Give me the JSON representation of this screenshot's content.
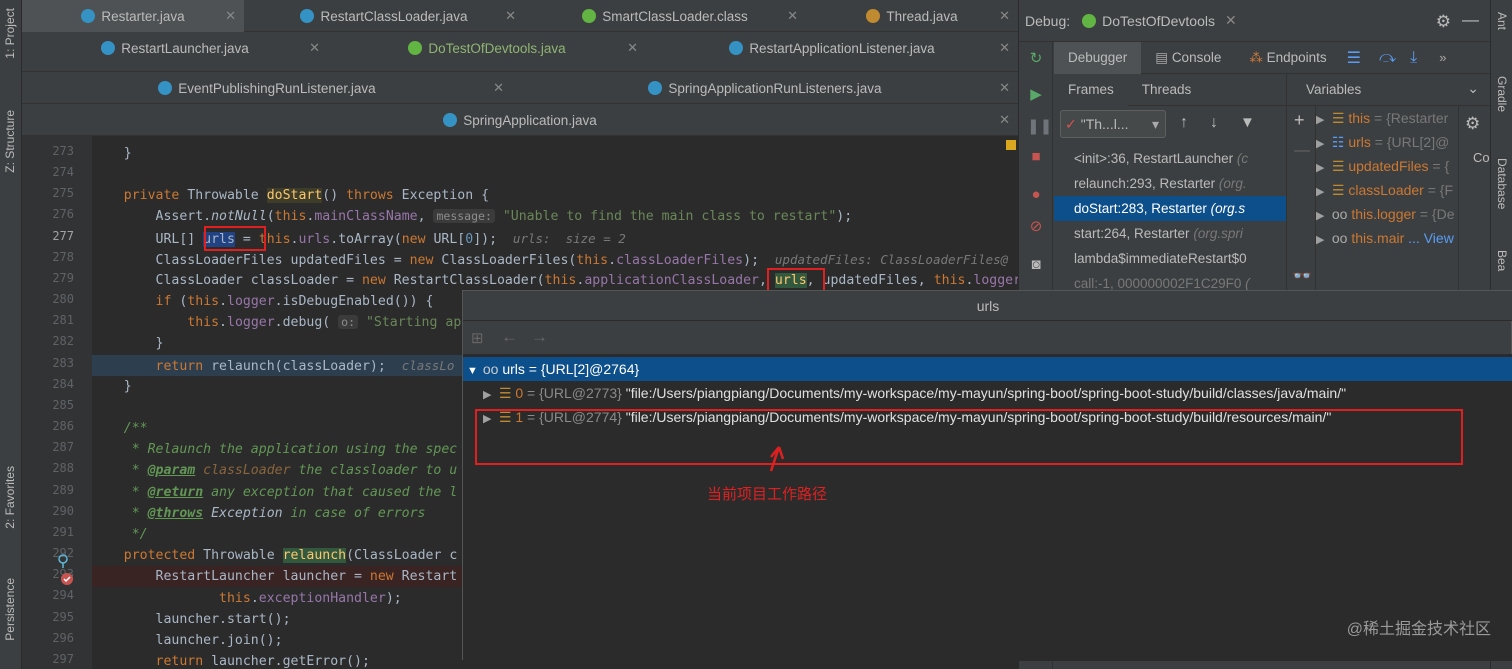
{
  "left_strip": {
    "items": [
      "1: Project",
      "Z: Structure",
      "2: Favorites",
      "Persistence"
    ]
  },
  "editor": {
    "tabs_row1": [
      {
        "label": "Restarter.java",
        "icon": "java-class-icon"
      },
      {
        "label": "RestartClassLoader.java",
        "icon": "java-class-icon"
      },
      {
        "label": "SmartClassLoader.class",
        "icon": "interface-icon"
      },
      {
        "label": "Thread.java",
        "icon": "java-class-icon"
      }
    ],
    "tabs_row2": [
      {
        "label": "RestartLauncher.java",
        "icon": "java-class-icon"
      },
      {
        "label": "DoTestOfDevtools.java",
        "icon": "spring-icon"
      },
      {
        "label": "RestartApplicationListener.java",
        "icon": "java-class-icon"
      }
    ],
    "tabs_row3": [
      {
        "label": "EventPublishingRunListener.java",
        "icon": "java-class-icon"
      },
      {
        "label": "SpringApplicationRunListeners.java",
        "icon": "java-class-icon"
      }
    ],
    "tabs_row4": [
      {
        "label": "SpringApplication.java",
        "icon": "java-class-icon"
      }
    ],
    "line_numbers": [
      "273",
      "274",
      "275",
      "276",
      "277",
      "278",
      "279",
      "280",
      "281",
      "282",
      "283",
      "284",
      "285",
      "286",
      "287",
      "288",
      "289",
      "290",
      "291",
      "292",
      "293",
      "294",
      "295",
      "296",
      "297"
    ],
    "code": {
      "l273": "}",
      "l275_kw": "private",
      "l275_type": " Throwable ",
      "l275_name": "doStart",
      "l275_rest": "() ",
      "l275_throws": "throws",
      "l275_exc": " Exception {",
      "l276_a": "Assert.",
      "l276_b": "notNull",
      "l276_c": "(",
      "l276_this": "this",
      "l276_d": ".",
      "l276_field": "mainClassName",
      "l276_e": ",",
      "l276_hint": "message:",
      "l276_str": "\"Unable to find the main class to restart\"",
      "l276_f": ");",
      "l277_a": "URL[] ",
      "l277_var": "urls",
      "l277_b": " = ",
      "l277_this": "this",
      "l277_c": ".",
      "l277_field": "urls",
      "l277_d": ".toArray(",
      "l277_new": "new",
      "l277_e": " URL[",
      "l277_num": "0",
      "l277_f": "]);",
      "l277_hint": "urls:  size = 2",
      "l278_a": "ClassLoaderFiles updatedFiles = ",
      "l278_new": "new",
      "l278_b": " ClassLoaderFiles(",
      "l278_this": "this",
      "l278_c": ".",
      "l278_field": "classLoaderFiles",
      "l278_d": ");",
      "l278_hint": "updatedFiles: ClassLoaderFiles@",
      "l279_a": "ClassLoader classLoader = ",
      "l279_new": "new",
      "l279_b": " RestartClassLoader(",
      "l279_this": "this",
      "l279_c": ".",
      "l279_field": "applicationClassLoader",
      "l279_d": ", ",
      "l279_var": "urls",
      "l279_e": ", updatedFiles, ",
      "l279_this2": "this",
      "l279_f": ".",
      "l279_field2": "logger",
      "l280_if": "if",
      "l280_a": " (",
      "l280_this": "this",
      "l280_b": ".",
      "l280_field": "logger",
      "l280_c": ".isDebugEnabled()) {",
      "l281_this": "this",
      "l281_a": ".",
      "l281_field": "logger",
      "l281_b": ".debug(",
      "l281_hint": "o:",
      "l281_str": "\"Starting app",
      "l282": "}",
      "l283_ret": "return",
      "l283_a": " relaunch(classLoader);",
      "l283_hint": "classLo",
      "l284": "}",
      "l286": "/**",
      "l287": " * Relaunch the application using the spec",
      "l288_a": " * ",
      "l288_tag": "@param",
      "l288_b": " classLoader",
      "l288_c": " the classloader to u",
      "l289_a": " * ",
      "l289_tag": "@return",
      "l289_b": " any exception that caused the l",
      "l290_a": " * ",
      "l290_tag": "@throws",
      "l290_b": " Exception",
      "l290_c": " in case of errors",
      "l291": " */",
      "l292_kw": "protected",
      "l292_a": " Throwable ",
      "l292_name": "relaunch",
      "l292_b": "(ClassLoader c",
      "l293_a": "RestartLauncher launcher = ",
      "l293_new": "new",
      "l293_b": " Restart",
      "l294_this": "this",
      "l294_a": ".",
      "l294_field": "exceptionHandler",
      "l294_b": ");",
      "l295": "launcher.start();",
      "l296": "launcher.join();",
      "l297_ret": "return",
      "l297_a": " launcher.getError();"
    }
  },
  "debug": {
    "header_label": "Debug:",
    "session_name": "DoTestOfDevtools",
    "tabs": [
      "Debugger",
      "Console",
      "Endpoints"
    ],
    "subtabs": [
      "Frames",
      "Threads"
    ],
    "variables_label": "Variables",
    "thread_select": "\"Th...l...",
    "frames": [
      {
        "name": "<init>:36, RestartLauncher",
        "detail": "(c"
      },
      {
        "name": "relaunch:293, Restarter",
        "detail": "(org."
      },
      {
        "name": "doStart:283, Restarter",
        "detail": "(org.s"
      },
      {
        "name": "start:264, Restarter",
        "detail": "(org.spri"
      },
      {
        "name": "lambda$immediateRestart$0",
        "detail": ""
      },
      {
        "name": "call:-1, 000000002F1C29F0",
        "detail": "("
      }
    ],
    "variables": [
      {
        "name": "this",
        "value": "= {Restarter"
      },
      {
        "name": "urls",
        "value": "= {URL[2]@"
      },
      {
        "name": "updatedFiles",
        "value": "= {"
      },
      {
        "name": "classLoader",
        "value": "= {F"
      },
      {
        "name": "this.logger",
        "value": "= {De"
      },
      {
        "name": "this.mair",
        "value": "... View"
      }
    ],
    "settings_panel_label": "Co"
  },
  "right_strip": {
    "items": [
      "Ant",
      "Gradle",
      "Database",
      "Bea"
    ]
  },
  "popup": {
    "title": "urls",
    "root": "urls = {URL[2]@2764}",
    "items": [
      {
        "index": "0",
        "ref": "{URL@2773}",
        "value": "\"file:/Users/piangpiang/Documents/my-workspace/my-mayun/spring-boot/spring-boot-study/build/classes/java/main/\""
      },
      {
        "index": "1",
        "ref": "{URL@2774}",
        "value": "\"file:/Users/piangpiang/Documents/my-workspace/my-mayun/spring-boot/spring-boot-study/build/resources/main/\""
      }
    ],
    "annotation": "当前项目工作路径"
  },
  "watermark": "@稀土掘金技术社区",
  "colors": {
    "keyword": "#cc7832",
    "field": "#9876aa",
    "string": "#6a8759",
    "method": "#ffc66d",
    "selection": "#0d4f8b",
    "annotation_red": "#e02020"
  }
}
